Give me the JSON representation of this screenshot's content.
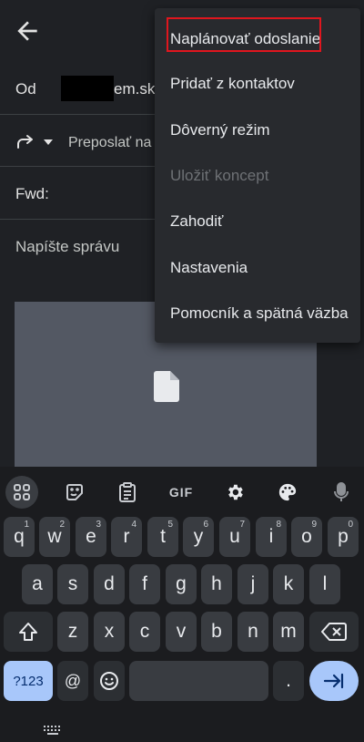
{
  "compose": {
    "from_label": "Od",
    "from_value": "em.sk",
    "reply_mode": "Preposlať na",
    "subject_value": "Fwd:",
    "body_placeholder": "Napíšte správu"
  },
  "menu": {
    "items": [
      {
        "label": "Naplánovať odoslanie",
        "highlighted": true
      },
      {
        "label": "Pridať z kontaktov"
      },
      {
        "label": "Dôverný režim"
      },
      {
        "label": "Uložiť koncept",
        "disabled": true
      },
      {
        "label": "Zahodiť"
      },
      {
        "label": "Nastavenia"
      },
      {
        "label": "Pomocník a spätná väzba"
      }
    ],
    "highlight_color": "#e0161e"
  },
  "keyboard": {
    "toolbar": {
      "gif_label": "GIF",
      "icons": [
        "apps-grid-icon",
        "sticker-icon",
        "clipboard-icon",
        "gif-icon",
        "settings-icon",
        "palette-icon",
        "microphone-icon"
      ]
    },
    "row1": [
      {
        "key": "q",
        "hint": "1"
      },
      {
        "key": "w",
        "hint": "2"
      },
      {
        "key": "e",
        "hint": "3"
      },
      {
        "key": "r",
        "hint": "4"
      },
      {
        "key": "t",
        "hint": "5"
      },
      {
        "key": "y",
        "hint": "6"
      },
      {
        "key": "u",
        "hint": "7"
      },
      {
        "key": "i",
        "hint": "8"
      },
      {
        "key": "o",
        "hint": "9"
      },
      {
        "key": "p",
        "hint": "0"
      }
    ],
    "row2": [
      "a",
      "s",
      "d",
      "f",
      "g",
      "h",
      "j",
      "k",
      "l"
    ],
    "row3": [
      "z",
      "x",
      "c",
      "v",
      "b",
      "n",
      "m"
    ],
    "symbols_label": "?123",
    "at_label": "@",
    "period_label": ".",
    "accent_color": "#a8c7fa"
  }
}
